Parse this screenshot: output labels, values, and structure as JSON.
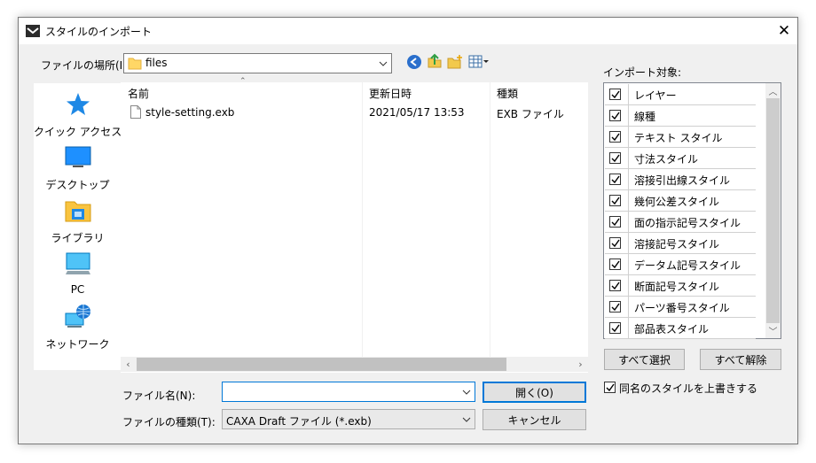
{
  "dialog": {
    "title": "スタイルのインポート",
    "close_glyph": "✕"
  },
  "location": {
    "label": "ファイルの場所(I):",
    "value": "files"
  },
  "places": [
    {
      "label": "クイック アクセス",
      "icon": "star-icon"
    },
    {
      "label": "デスクトップ",
      "icon": "desktop-icon"
    },
    {
      "label": "ライブラリ",
      "icon": "library-icon"
    },
    {
      "label": "PC",
      "icon": "pc-icon"
    },
    {
      "label": "ネットワーク",
      "icon": "network-icon"
    }
  ],
  "filelist": {
    "columns": [
      "名前",
      "更新日時",
      "種類"
    ],
    "rows": [
      {
        "name": "style-setting.exb",
        "modified": "2021/05/17 13:53",
        "type": "EXB ファイル"
      }
    ]
  },
  "filename": {
    "label": "ファイル名(N):",
    "value": ""
  },
  "filetype": {
    "label": "ファイルの種類(T):",
    "value": "CAXA Draft ファイル (*.exb)"
  },
  "buttons": {
    "open": "開く(O)",
    "cancel": "キャンセル",
    "select_all": "すべて選択",
    "deselect_all": "すべて解除"
  },
  "targets": {
    "label": "インポート対象:",
    "items": [
      {
        "label": "レイヤー",
        "checked": true
      },
      {
        "label": "線種",
        "checked": true
      },
      {
        "label": "テキスト スタイル",
        "checked": true
      },
      {
        "label": "寸法スタイル",
        "checked": true
      },
      {
        "label": "溶接引出線スタイル",
        "checked": true
      },
      {
        "label": "幾何公差スタイル",
        "checked": true
      },
      {
        "label": "面の指示記号スタイル",
        "checked": true
      },
      {
        "label": "溶接記号スタイル",
        "checked": true
      },
      {
        "label": "データム記号スタイル",
        "checked": true
      },
      {
        "label": "断面記号スタイル",
        "checked": true
      },
      {
        "label": "パーツ番号スタイル",
        "checked": true
      },
      {
        "label": "部品表スタイル",
        "checked": true
      }
    ]
  },
  "overwrite": {
    "label": "同名のスタイルを上書きする",
    "checked": true
  }
}
